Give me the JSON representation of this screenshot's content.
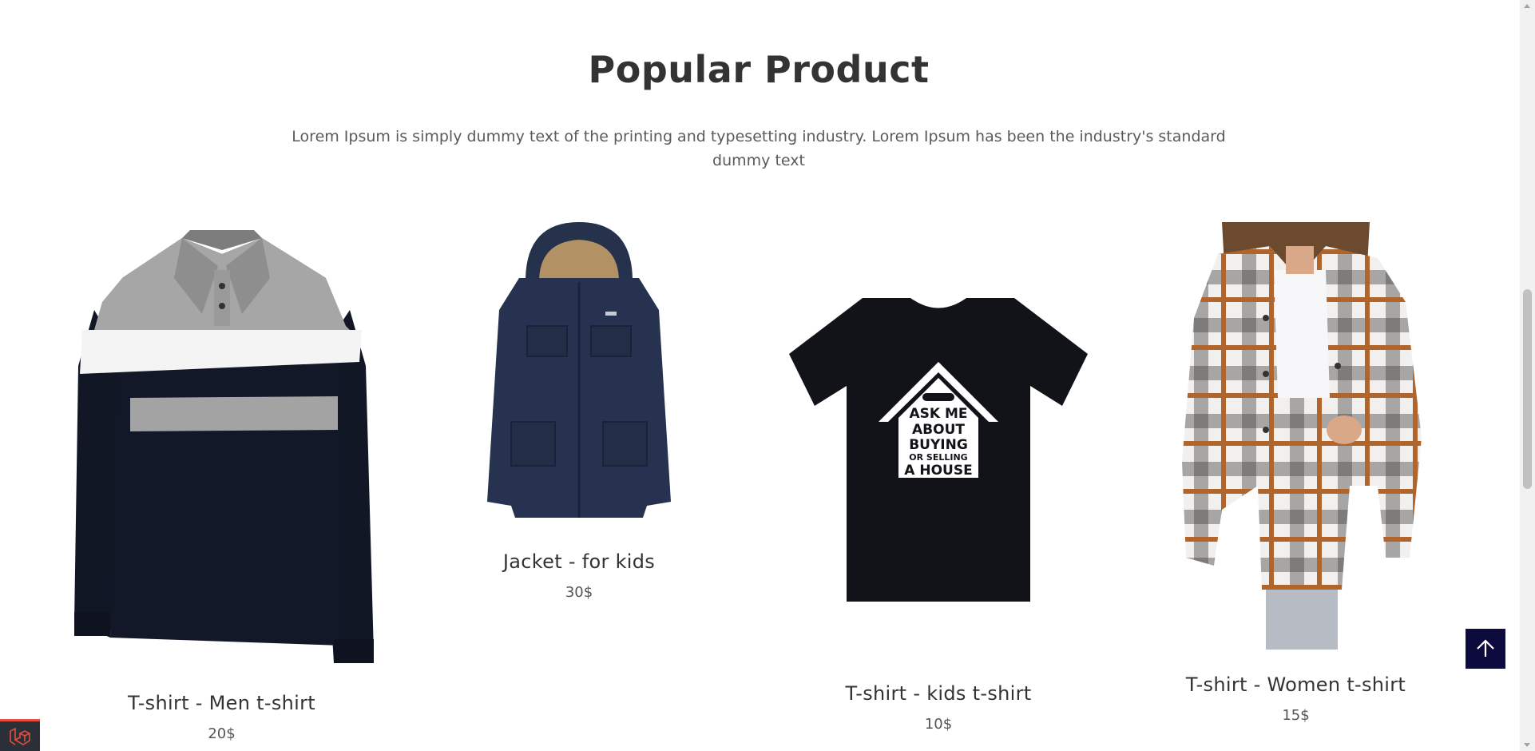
{
  "section": {
    "title": "Popular Product",
    "subtitle": "Lorem Ipsum is simply dummy text of the printing and typesetting industry. Lorem Ipsum has been the industry's standard dummy text"
  },
  "products": [
    {
      "name": "T-shirt - Men t-shirt",
      "price": "20$",
      "image": "men-polo-shirt"
    },
    {
      "name": "Jacket - for kids",
      "price": "30$",
      "image": "navy-parka-jacket"
    },
    {
      "name": "T-shirt - kids t-shirt",
      "price": "10$",
      "image": "black-house-print-tshirt"
    },
    {
      "name": "T-shirt - Women t-shirt",
      "price": "15$",
      "image": "plaid-shacket-woman"
    }
  ],
  "tshirt_print": {
    "line1": "ASK ME",
    "line2": "ABOUT",
    "line3": "BUYING",
    "line4": "OR SELLING",
    "line5": "A HOUSE"
  },
  "icons": {
    "back_to_top": "arrow-up-icon",
    "debug_badge": "laravel-logo-icon"
  },
  "colors": {
    "back_to_top_bg": "#0d0b3d",
    "badge_accent": "#e74c3c"
  }
}
